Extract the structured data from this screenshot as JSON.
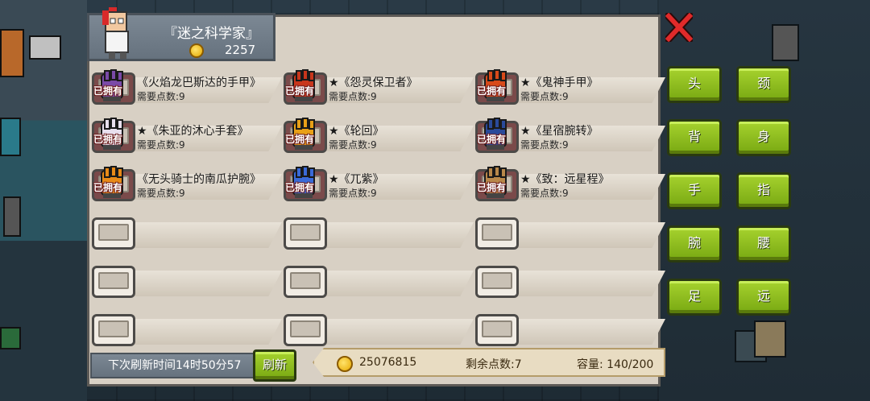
{
  "player": {
    "name": "『迷之科学家』",
    "gold": "2257"
  },
  "owned_tag": "已拥有",
  "items": [
    {
      "name": "《火焰龙巴斯达的手甲》",
      "cost": "需要点数:9",
      "owned": true,
      "color": "#7a4aa8"
    },
    {
      "name": "★《怨灵保卫者》",
      "cost": "需要点数:9",
      "owned": true,
      "color": "#c8361c"
    },
    {
      "name": "★《鬼神手甲》",
      "cost": "需要点数:9",
      "owned": true,
      "color": "#d84a1a"
    },
    {
      "name": "★《朱亚的沐心手套》",
      "cost": "需要点数:9",
      "owned": true,
      "color": "#e8e0ee"
    },
    {
      "name": "★《轮回》",
      "cost": "需要点数:9",
      "owned": true,
      "color": "#e8a018"
    },
    {
      "name": "★《星宿腕转》",
      "cost": "需要点数:9",
      "owned": true,
      "color": "#2a4a9a"
    },
    {
      "name": "《无头骑士的南瓜护腕》",
      "cost": "需要点数:9",
      "owned": true,
      "color": "#e88a18"
    },
    {
      "name": "★《兀紫》",
      "cost": "需要点数:9",
      "owned": true,
      "color": "#3a6ad8"
    },
    {
      "name": "★《致：远星程》",
      "cost": "需要点数:9",
      "owned": true,
      "color": "#b8884a"
    }
  ],
  "categories": [
    "头",
    "颈",
    "背",
    "身",
    "手",
    "指",
    "腕",
    "腰",
    "足",
    "远"
  ],
  "bottom": {
    "refresh_time": "下次刷新时间14时50分57",
    "refresh_button": "刷新",
    "total_gold": "25076815",
    "remaining_points": "剩余点数:7",
    "capacity": "容量:  140/200"
  },
  "colors": {
    "accent_green": "#8cbc1e",
    "panel": "#d8d0c4",
    "owned_text": "#ffffff"
  }
}
